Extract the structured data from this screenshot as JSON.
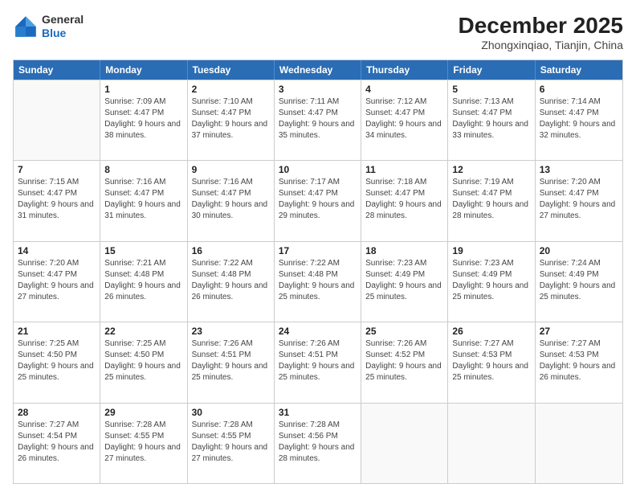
{
  "header": {
    "logo": {
      "general": "General",
      "blue": "Blue"
    },
    "title": "December 2025",
    "subtitle": "Zhongxinqiao, Tianjin, China"
  },
  "calendar": {
    "days_of_week": [
      "Sunday",
      "Monday",
      "Tuesday",
      "Wednesday",
      "Thursday",
      "Friday",
      "Saturday"
    ],
    "rows": [
      [
        {
          "day": "",
          "sunrise": "",
          "sunset": "",
          "daylight": ""
        },
        {
          "day": "1",
          "sunrise": "Sunrise: 7:09 AM",
          "sunset": "Sunset: 4:47 PM",
          "daylight": "Daylight: 9 hours and 38 minutes."
        },
        {
          "day": "2",
          "sunrise": "Sunrise: 7:10 AM",
          "sunset": "Sunset: 4:47 PM",
          "daylight": "Daylight: 9 hours and 37 minutes."
        },
        {
          "day": "3",
          "sunrise": "Sunrise: 7:11 AM",
          "sunset": "Sunset: 4:47 PM",
          "daylight": "Daylight: 9 hours and 35 minutes."
        },
        {
          "day": "4",
          "sunrise": "Sunrise: 7:12 AM",
          "sunset": "Sunset: 4:47 PM",
          "daylight": "Daylight: 9 hours and 34 minutes."
        },
        {
          "day": "5",
          "sunrise": "Sunrise: 7:13 AM",
          "sunset": "Sunset: 4:47 PM",
          "daylight": "Daylight: 9 hours and 33 minutes."
        },
        {
          "day": "6",
          "sunrise": "Sunrise: 7:14 AM",
          "sunset": "Sunset: 4:47 PM",
          "daylight": "Daylight: 9 hours and 32 minutes."
        }
      ],
      [
        {
          "day": "7",
          "sunrise": "Sunrise: 7:15 AM",
          "sunset": "Sunset: 4:47 PM",
          "daylight": "Daylight: 9 hours and 31 minutes."
        },
        {
          "day": "8",
          "sunrise": "Sunrise: 7:16 AM",
          "sunset": "Sunset: 4:47 PM",
          "daylight": "Daylight: 9 hours and 31 minutes."
        },
        {
          "day": "9",
          "sunrise": "Sunrise: 7:16 AM",
          "sunset": "Sunset: 4:47 PM",
          "daylight": "Daylight: 9 hours and 30 minutes."
        },
        {
          "day": "10",
          "sunrise": "Sunrise: 7:17 AM",
          "sunset": "Sunset: 4:47 PM",
          "daylight": "Daylight: 9 hours and 29 minutes."
        },
        {
          "day": "11",
          "sunrise": "Sunrise: 7:18 AM",
          "sunset": "Sunset: 4:47 PM",
          "daylight": "Daylight: 9 hours and 28 minutes."
        },
        {
          "day": "12",
          "sunrise": "Sunrise: 7:19 AM",
          "sunset": "Sunset: 4:47 PM",
          "daylight": "Daylight: 9 hours and 28 minutes."
        },
        {
          "day": "13",
          "sunrise": "Sunrise: 7:20 AM",
          "sunset": "Sunset: 4:47 PM",
          "daylight": "Daylight: 9 hours and 27 minutes."
        }
      ],
      [
        {
          "day": "14",
          "sunrise": "Sunrise: 7:20 AM",
          "sunset": "Sunset: 4:47 PM",
          "daylight": "Daylight: 9 hours and 27 minutes."
        },
        {
          "day": "15",
          "sunrise": "Sunrise: 7:21 AM",
          "sunset": "Sunset: 4:48 PM",
          "daylight": "Daylight: 9 hours and 26 minutes."
        },
        {
          "day": "16",
          "sunrise": "Sunrise: 7:22 AM",
          "sunset": "Sunset: 4:48 PM",
          "daylight": "Daylight: 9 hours and 26 minutes."
        },
        {
          "day": "17",
          "sunrise": "Sunrise: 7:22 AM",
          "sunset": "Sunset: 4:48 PM",
          "daylight": "Daylight: 9 hours and 25 minutes."
        },
        {
          "day": "18",
          "sunrise": "Sunrise: 7:23 AM",
          "sunset": "Sunset: 4:49 PM",
          "daylight": "Daylight: 9 hours and 25 minutes."
        },
        {
          "day": "19",
          "sunrise": "Sunrise: 7:23 AM",
          "sunset": "Sunset: 4:49 PM",
          "daylight": "Daylight: 9 hours and 25 minutes."
        },
        {
          "day": "20",
          "sunrise": "Sunrise: 7:24 AM",
          "sunset": "Sunset: 4:49 PM",
          "daylight": "Daylight: 9 hours and 25 minutes."
        }
      ],
      [
        {
          "day": "21",
          "sunrise": "Sunrise: 7:25 AM",
          "sunset": "Sunset: 4:50 PM",
          "daylight": "Daylight: 9 hours and 25 minutes."
        },
        {
          "day": "22",
          "sunrise": "Sunrise: 7:25 AM",
          "sunset": "Sunset: 4:50 PM",
          "daylight": "Daylight: 9 hours and 25 minutes."
        },
        {
          "day": "23",
          "sunrise": "Sunrise: 7:26 AM",
          "sunset": "Sunset: 4:51 PM",
          "daylight": "Daylight: 9 hours and 25 minutes."
        },
        {
          "day": "24",
          "sunrise": "Sunrise: 7:26 AM",
          "sunset": "Sunset: 4:51 PM",
          "daylight": "Daylight: 9 hours and 25 minutes."
        },
        {
          "day": "25",
          "sunrise": "Sunrise: 7:26 AM",
          "sunset": "Sunset: 4:52 PM",
          "daylight": "Daylight: 9 hours and 25 minutes."
        },
        {
          "day": "26",
          "sunrise": "Sunrise: 7:27 AM",
          "sunset": "Sunset: 4:53 PM",
          "daylight": "Daylight: 9 hours and 25 minutes."
        },
        {
          "day": "27",
          "sunrise": "Sunrise: 7:27 AM",
          "sunset": "Sunset: 4:53 PM",
          "daylight": "Daylight: 9 hours and 26 minutes."
        }
      ],
      [
        {
          "day": "28",
          "sunrise": "Sunrise: 7:27 AM",
          "sunset": "Sunset: 4:54 PM",
          "daylight": "Daylight: 9 hours and 26 minutes."
        },
        {
          "day": "29",
          "sunrise": "Sunrise: 7:28 AM",
          "sunset": "Sunset: 4:55 PM",
          "daylight": "Daylight: 9 hours and 27 minutes."
        },
        {
          "day": "30",
          "sunrise": "Sunrise: 7:28 AM",
          "sunset": "Sunset: 4:55 PM",
          "daylight": "Daylight: 9 hours and 27 minutes."
        },
        {
          "day": "31",
          "sunrise": "Sunrise: 7:28 AM",
          "sunset": "Sunset: 4:56 PM",
          "daylight": "Daylight: 9 hours and 28 minutes."
        },
        {
          "day": "",
          "sunrise": "",
          "sunset": "",
          "daylight": ""
        },
        {
          "day": "",
          "sunrise": "",
          "sunset": "",
          "daylight": ""
        },
        {
          "day": "",
          "sunrise": "",
          "sunset": "",
          "daylight": ""
        }
      ]
    ]
  }
}
